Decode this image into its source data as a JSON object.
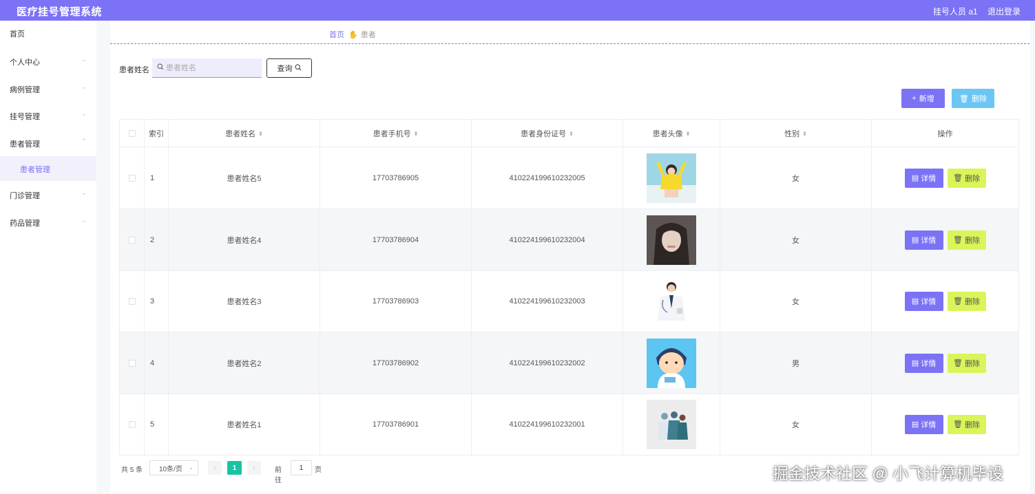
{
  "app": {
    "title": "医疗挂号管理系统",
    "user": "挂号人员 a1",
    "logout": "退出登录"
  },
  "sidebar": {
    "items": [
      {
        "label": "首页"
      },
      {
        "label": "个人中心"
      },
      {
        "label": "病例管理"
      },
      {
        "label": "挂号管理"
      },
      {
        "label": "患者管理"
      },
      {
        "label": "患者管理"
      },
      {
        "label": "门诊管理"
      },
      {
        "label": "药品管理"
      }
    ]
  },
  "breadcrumb": {
    "home": "首页",
    "current": "患者"
  },
  "search": {
    "label": "患者姓名",
    "placeholder": "患者姓名",
    "value": "",
    "button": "查询"
  },
  "toolbar": {
    "add": "新增",
    "delete": "删除"
  },
  "table": {
    "columns": [
      "索引",
      "患者姓名",
      "患者手机号",
      "患者身份证号",
      "患者头像",
      "性别",
      "操作"
    ],
    "rows": [
      {
        "index": "1",
        "name": "患者姓名5",
        "phone": "17703786905",
        "id_card": "410224199610232005",
        "gender": "女",
        "avatar": "woman-in-yellow-avatar"
      },
      {
        "index": "2",
        "name": "患者姓名4",
        "phone": "17703786904",
        "id_card": "410224199610232004",
        "gender": "女",
        "avatar": "woman-portrait-avatar"
      },
      {
        "index": "3",
        "name": "患者姓名3",
        "phone": "17703786903",
        "id_card": "410224199610232003",
        "gender": "女",
        "avatar": "doctor-avatar"
      },
      {
        "index": "4",
        "name": "患者姓名2",
        "phone": "17703786902",
        "id_card": "410224199610232002",
        "gender": "男",
        "avatar": "cartoon-doctor-avatar"
      },
      {
        "index": "5",
        "name": "患者姓名1",
        "phone": "17703786901",
        "id_card": "410224199610232001",
        "gender": "女",
        "avatar": "medical-team-avatar"
      }
    ],
    "detail_label": "详情",
    "delete_label": "删除"
  },
  "pagination": {
    "total": "共 5 条",
    "page_size": "10条/页",
    "current_page": "1",
    "goto_label": "前往",
    "goto_value": "1",
    "page_suffix": "页"
  },
  "watermark": "掘金技术社区 @ 小飞计算机毕设",
  "colors": {
    "primary": "#7b72f5",
    "info": "#6cc6f3",
    "danger": "#d9f55a",
    "active_page": "#19c3a4"
  }
}
